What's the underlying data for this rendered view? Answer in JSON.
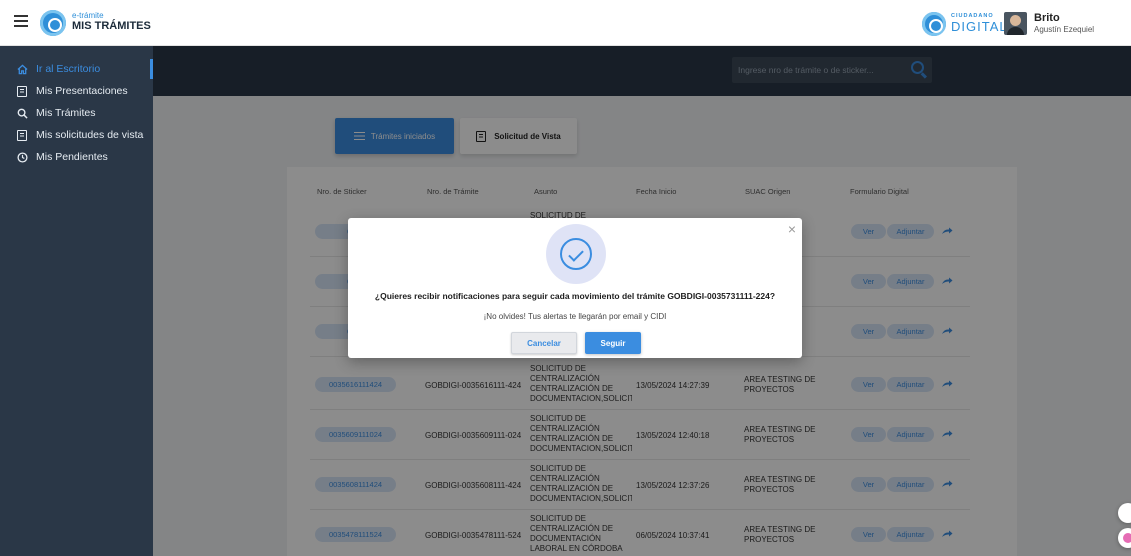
{
  "header": {
    "brand_small": "e-trámite",
    "brand_big": "MIS TRÁMITES",
    "cd_small": "CIUDADANO",
    "cd_big": "DIGITAL",
    "user_name": "Brito",
    "user_sub": "Agustín Ezequiel"
  },
  "sidebar": {
    "items": [
      {
        "label": "Ir al Escritorio",
        "icon": "home-icon"
      },
      {
        "label": "Mis Presentaciones",
        "icon": "document-icon"
      },
      {
        "label": "Mis Trámites",
        "icon": "search-icon"
      },
      {
        "label": "Mis solicitudes de vista",
        "icon": "document-icon"
      },
      {
        "label": "Mis Pendientes",
        "icon": "clock-icon"
      }
    ]
  },
  "search": {
    "placeholder": "Ingrese nro de trámite o de sticker..."
  },
  "tabs": {
    "iniciados": "Trámites iniciados",
    "vista": "Solicitud de Vista"
  },
  "table": {
    "headers": [
      "Nro. de Sticker",
      "Nro. de Trámite",
      "Asunto",
      "Fecha Inicio",
      "SUAC Origen",
      "Formulario Digital"
    ],
    "rows": [
      {
        "sticker": "0035",
        "tramite": "",
        "asunto": "SOLICITUD DE",
        "fecha": "",
        "suac": "DE"
      },
      {
        "sticker": "0035",
        "tramite": "",
        "asunto": "",
        "fecha": "",
        "suac": "DE"
      },
      {
        "sticker": "0035",
        "tramite": "",
        "asunto": "",
        "fecha": "",
        "suac": "DE"
      },
      {
        "sticker": "0035616111424",
        "tramite": "GOBDIGI-0035616111-424",
        "asunto": "SOLICITUD DE CENTRALIZACIÓN CENTRALIZACIÓN DE DOCUMENTACION,SOLICIT...",
        "fecha": "13/05/2024 14:27:39",
        "suac": "AREA TESTING DE PROYECTOS"
      },
      {
        "sticker": "0035609111024",
        "tramite": "GOBDIGI-0035609111-024",
        "asunto": "SOLICITUD DE CENTRALIZACIÓN CENTRALIZACIÓN DE DOCUMENTACION,SOLICIT...",
        "fecha": "13/05/2024 12:40:18",
        "suac": "AREA TESTING DE PROYECTOS"
      },
      {
        "sticker": "0035608111424",
        "tramite": "GOBDIGI-0035608111-424",
        "asunto": "SOLICITUD DE CENTRALIZACIÓN CENTRALIZACIÓN DE DOCUMENTACION,SOLICIT...",
        "fecha": "13/05/2024 12:37:26",
        "suac": "AREA TESTING DE PROYECTOS"
      },
      {
        "sticker": "0035478111524",
        "tramite": "GOBDIGI-0035478111-524",
        "asunto": "SOLICITUD DE CENTRALIZACIÓN DE DOCUMENTACIÓN LABORAL EN CÓRDOBA",
        "fecha": "06/05/2024 10:37:41",
        "suac": "AREA TESTING DE PROYECTOS"
      }
    ],
    "ver_label": "Ver",
    "adjuntar_label": "Adjuntar"
  },
  "modal": {
    "question": "¿Quieres recibir notificaciones para seguir cada movimiento del trámite GOBDIGI-0035731111-224?",
    "note": "¡No olvides! Tus alertas te llegarán por email y CIDI",
    "cancel_label": "Cancelar",
    "follow_label": "Seguir",
    "close_glyph": "×"
  },
  "colors": {
    "accent": "#3b8de0",
    "sidebar": "#2a3747",
    "pill": "#d8e6f7"
  }
}
